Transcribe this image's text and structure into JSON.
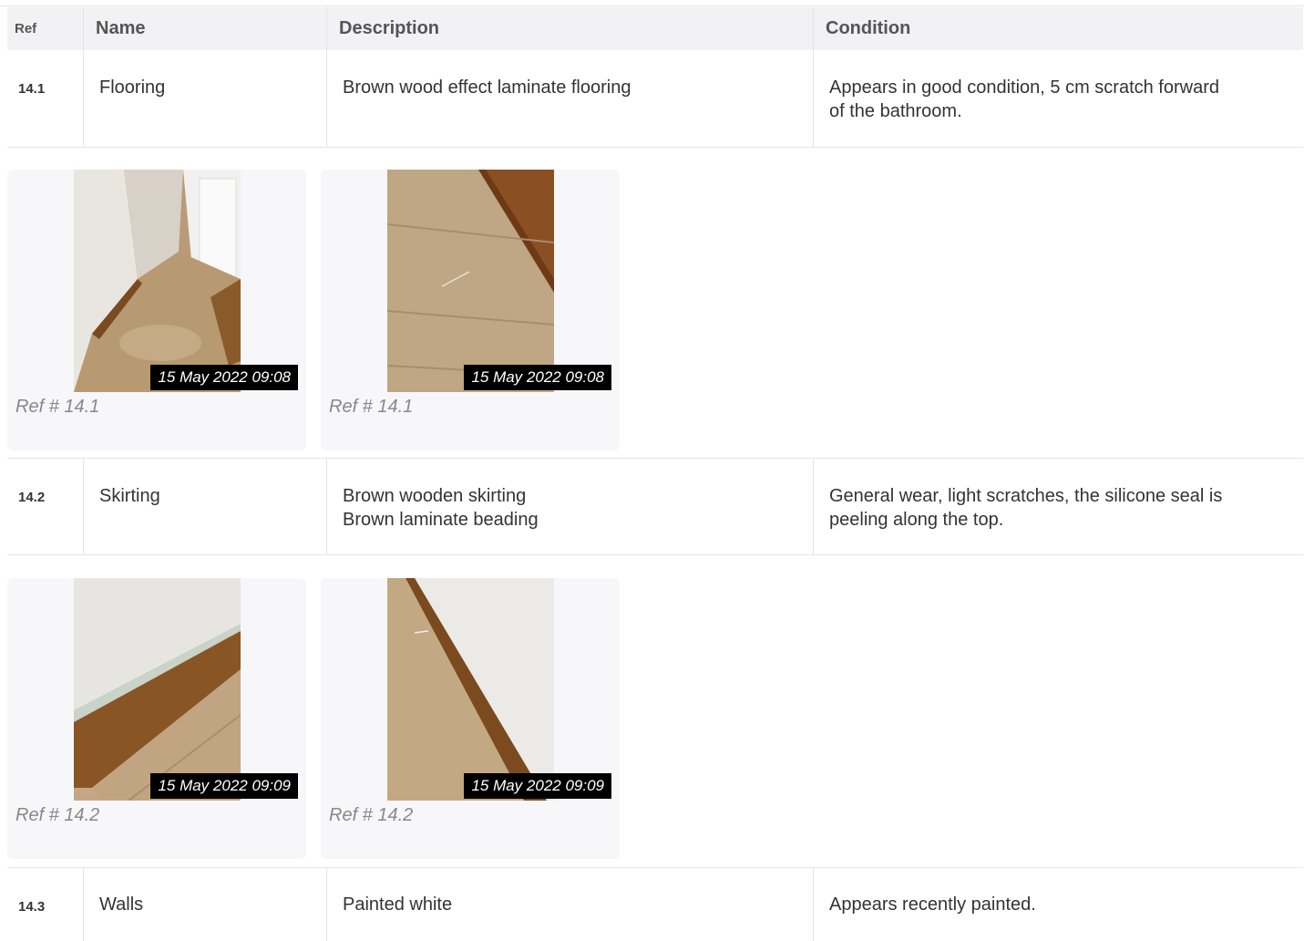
{
  "header": {
    "ref": "Ref",
    "name": "Name",
    "description": "Description",
    "condition": "Condition"
  },
  "items": [
    {
      "ref": "14.1",
      "name": "Flooring",
      "description": [
        "Brown wood effect laminate flooring"
      ],
      "condition": [
        "Appears in good condition, 5 cm scratch forward",
        "of the bathroom."
      ],
      "photos": [
        {
          "timestamp": "15 May 2022 09:08",
          "caption": "Ref # 14.1"
        },
        {
          "timestamp": "15 May 2022 09:08",
          "caption": "Ref # 14.1"
        }
      ]
    },
    {
      "ref": "14.2",
      "name": "Skirting",
      "description": [
        "Brown wooden skirting",
        "Brown laminate beading"
      ],
      "condition": [
        "General wear, light scratches, the silicone seal is",
        "peeling along the top."
      ],
      "photos": [
        {
          "timestamp": "15 May 2022 09:09",
          "caption": "Ref # 14.2"
        },
        {
          "timestamp": "15 May 2022 09:09",
          "caption": "Ref # 14.2"
        }
      ]
    },
    {
      "ref": "14.3",
      "name": "Walls",
      "description": [
        "Painted white"
      ],
      "condition": [
        "Appears recently painted."
      ]
    }
  ]
}
